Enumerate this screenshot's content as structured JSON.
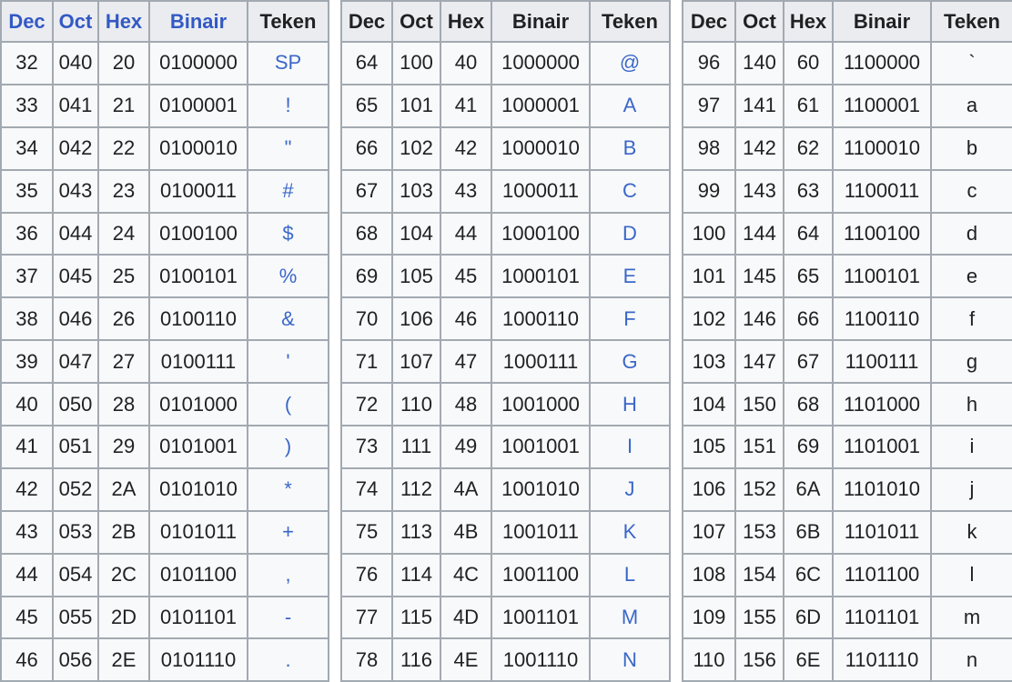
{
  "tables": [
    {
      "headers": [
        {
          "label": "Dec",
          "link": true
        },
        {
          "label": "Oct",
          "link": true
        },
        {
          "label": "Hex",
          "link": true
        },
        {
          "label": "Binair",
          "link": true
        },
        {
          "label": "Teken",
          "link": false
        }
      ],
      "char_style": "link",
      "rows": [
        {
          "dec": "32",
          "oct": "040",
          "hex": "20",
          "bin": "0100000",
          "ch": "SP"
        },
        {
          "dec": "33",
          "oct": "041",
          "hex": "21",
          "bin": "0100001",
          "ch": "!"
        },
        {
          "dec": "34",
          "oct": "042",
          "hex": "22",
          "bin": "0100010",
          "ch": "\""
        },
        {
          "dec": "35",
          "oct": "043",
          "hex": "23",
          "bin": "0100011",
          "ch": "#"
        },
        {
          "dec": "36",
          "oct": "044",
          "hex": "24",
          "bin": "0100100",
          "ch": "$"
        },
        {
          "dec": "37",
          "oct": "045",
          "hex": "25",
          "bin": "0100101",
          "ch": "%"
        },
        {
          "dec": "38",
          "oct": "046",
          "hex": "26",
          "bin": "0100110",
          "ch": "&"
        },
        {
          "dec": "39",
          "oct": "047",
          "hex": "27",
          "bin": "0100111",
          "ch": "'"
        },
        {
          "dec": "40",
          "oct": "050",
          "hex": "28",
          "bin": "0101000",
          "ch": "("
        },
        {
          "dec": "41",
          "oct": "051",
          "hex": "29",
          "bin": "0101001",
          "ch": ")"
        },
        {
          "dec": "42",
          "oct": "052",
          "hex": "2A",
          "bin": "0101010",
          "ch": "*"
        },
        {
          "dec": "43",
          "oct": "053",
          "hex": "2B",
          "bin": "0101011",
          "ch": "+"
        },
        {
          "dec": "44",
          "oct": "054",
          "hex": "2C",
          "bin": "0101100",
          "ch": ","
        },
        {
          "dec": "45",
          "oct": "055",
          "hex": "2D",
          "bin": "0101101",
          "ch": "-"
        },
        {
          "dec": "46",
          "oct": "056",
          "hex": "2E",
          "bin": "0101110",
          "ch": "."
        }
      ]
    },
    {
      "headers": [
        {
          "label": "Dec",
          "link": false
        },
        {
          "label": "Oct",
          "link": false
        },
        {
          "label": "Hex",
          "link": false
        },
        {
          "label": "Binair",
          "link": false
        },
        {
          "label": "Teken",
          "link": false
        }
      ],
      "char_style": "link",
      "rows": [
        {
          "dec": "64",
          "oct": "100",
          "hex": "40",
          "bin": "1000000",
          "ch": "@"
        },
        {
          "dec": "65",
          "oct": "101",
          "hex": "41",
          "bin": "1000001",
          "ch": "A"
        },
        {
          "dec": "66",
          "oct": "102",
          "hex": "42",
          "bin": "1000010",
          "ch": "B"
        },
        {
          "dec": "67",
          "oct": "103",
          "hex": "43",
          "bin": "1000011",
          "ch": "C"
        },
        {
          "dec": "68",
          "oct": "104",
          "hex": "44",
          "bin": "1000100",
          "ch": "D"
        },
        {
          "dec": "69",
          "oct": "105",
          "hex": "45",
          "bin": "1000101",
          "ch": "E"
        },
        {
          "dec": "70",
          "oct": "106",
          "hex": "46",
          "bin": "1000110",
          "ch": "F"
        },
        {
          "dec": "71",
          "oct": "107",
          "hex": "47",
          "bin": "1000111",
          "ch": "G"
        },
        {
          "dec": "72",
          "oct": "110",
          "hex": "48",
          "bin": "1001000",
          "ch": "H"
        },
        {
          "dec": "73",
          "oct": "111",
          "hex": "49",
          "bin": "1001001",
          "ch": "I"
        },
        {
          "dec": "74",
          "oct": "112",
          "hex": "4A",
          "bin": "1001010",
          "ch": "J"
        },
        {
          "dec": "75",
          "oct": "113",
          "hex": "4B",
          "bin": "1001011",
          "ch": "K"
        },
        {
          "dec": "76",
          "oct": "114",
          "hex": "4C",
          "bin": "1001100",
          "ch": "L"
        },
        {
          "dec": "77",
          "oct": "115",
          "hex": "4D",
          "bin": "1001101",
          "ch": "M"
        },
        {
          "dec": "78",
          "oct": "116",
          "hex": "4E",
          "bin": "1001110",
          "ch": "N"
        }
      ]
    },
    {
      "headers": [
        {
          "label": "Dec",
          "link": false
        },
        {
          "label": "Oct",
          "link": false
        },
        {
          "label": "Hex",
          "link": false
        },
        {
          "label": "Binair",
          "link": false
        },
        {
          "label": "Teken",
          "link": false
        }
      ],
      "char_style": "plain",
      "rows": [
        {
          "dec": "96",
          "oct": "140",
          "hex": "60",
          "bin": "1100000",
          "ch": "`"
        },
        {
          "dec": "97",
          "oct": "141",
          "hex": "61",
          "bin": "1100001",
          "ch": "a"
        },
        {
          "dec": "98",
          "oct": "142",
          "hex": "62",
          "bin": "1100010",
          "ch": "b"
        },
        {
          "dec": "99",
          "oct": "143",
          "hex": "63",
          "bin": "1100011",
          "ch": "c"
        },
        {
          "dec": "100",
          "oct": "144",
          "hex": "64",
          "bin": "1100100",
          "ch": "d"
        },
        {
          "dec": "101",
          "oct": "145",
          "hex": "65",
          "bin": "1100101",
          "ch": "e"
        },
        {
          "dec": "102",
          "oct": "146",
          "hex": "66",
          "bin": "1100110",
          "ch": "f"
        },
        {
          "dec": "103",
          "oct": "147",
          "hex": "67",
          "bin": "1100111",
          "ch": "g"
        },
        {
          "dec": "104",
          "oct": "150",
          "hex": "68",
          "bin": "1101000",
          "ch": "h"
        },
        {
          "dec": "105",
          "oct": "151",
          "hex": "69",
          "bin": "1101001",
          "ch": "i"
        },
        {
          "dec": "106",
          "oct": "152",
          "hex": "6A",
          "bin": "1101010",
          "ch": "j"
        },
        {
          "dec": "107",
          "oct": "153",
          "hex": "6B",
          "bin": "1101011",
          "ch": "k"
        },
        {
          "dec": "108",
          "oct": "154",
          "hex": "6C",
          "bin": "1101100",
          "ch": "l"
        },
        {
          "dec": "109",
          "oct": "155",
          "hex": "6D",
          "bin": "1101101",
          "ch": "m"
        },
        {
          "dec": "110",
          "oct": "156",
          "hex": "6E",
          "bin": "1101110",
          "ch": "n"
        }
      ]
    }
  ],
  "colors": {
    "link": "#3359c4",
    "text": "#202122",
    "header_bg": "#eaecf0",
    "cell_bg": "#f8f9fa",
    "border": "#a2a9b1"
  }
}
